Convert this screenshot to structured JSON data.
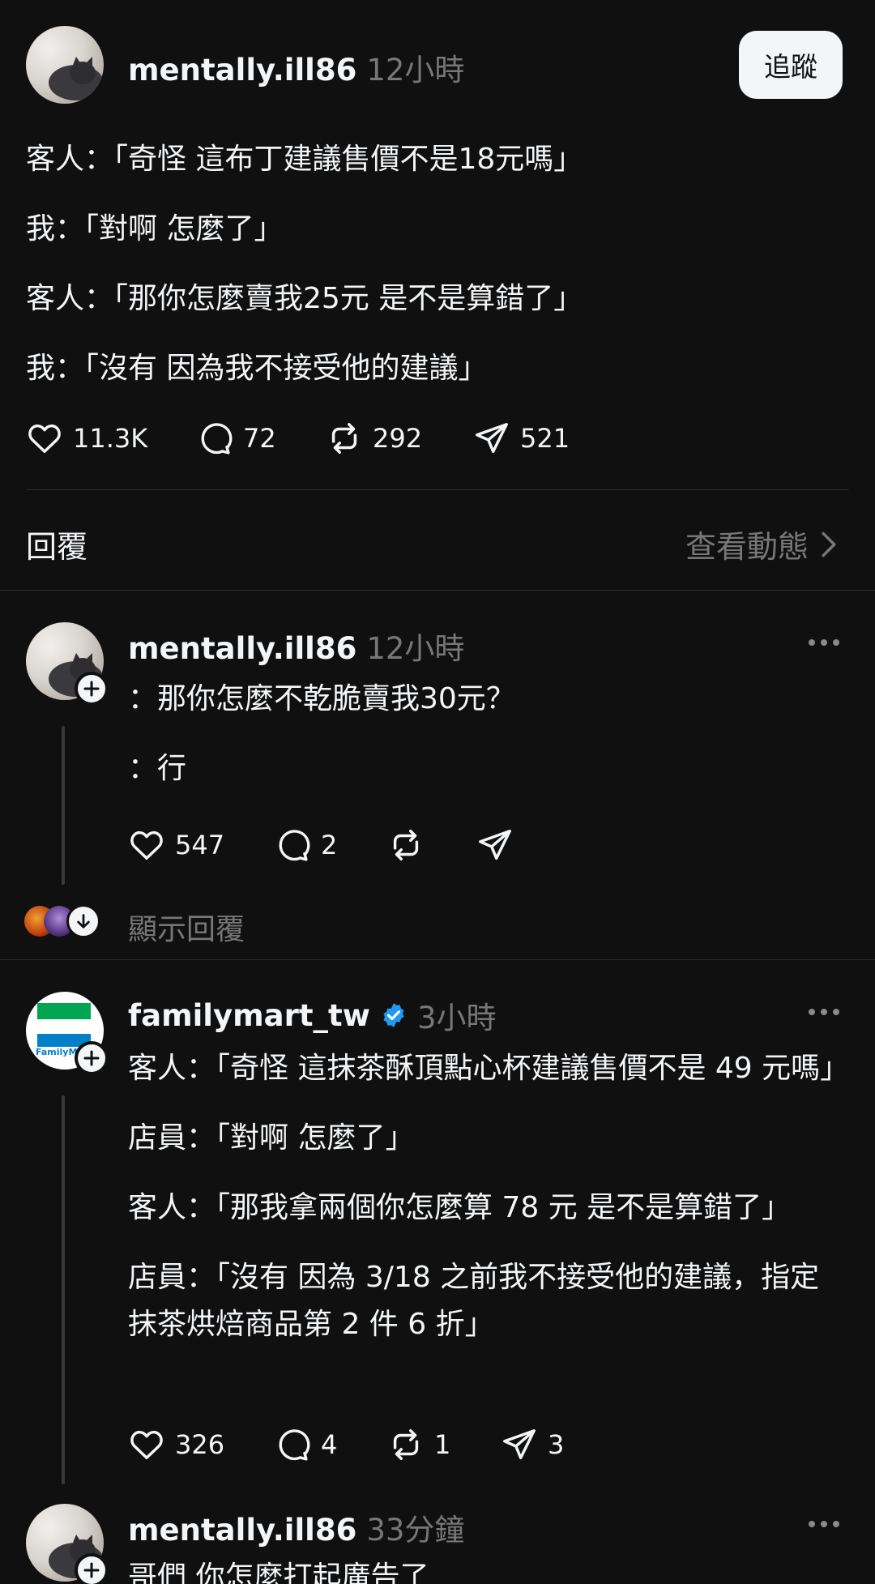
{
  "main_post": {
    "username": "mentally.ill86",
    "time": "12小時",
    "follow_label": "追蹤",
    "lines": [
      "客人：「奇怪 這布丁建議售價不是18元嗎」",
      "我：「對啊 怎麼了」",
      "客人：「那你怎麼賣我25元 是不是算錯了」",
      "我：「沒有 因為我不接受他的建議」"
    ],
    "likes": "11.3K",
    "comments": "72",
    "reposts": "292",
    "shares": "521"
  },
  "replies_header": {
    "label": "回覆",
    "activity_link": "查看動態"
  },
  "reply1": {
    "username": "mentally.ill86",
    "time": "12小時",
    "lines": [
      "：那你怎麼不乾脆賣我30元？",
      "：行"
    ],
    "likes": "547",
    "comments": "2",
    "show_replies": "顯示回覆"
  },
  "reply2": {
    "username": "familymart_tw",
    "time": "3小時",
    "avatar_text": "FamilyMart",
    "lines": [
      "客人：「奇怪 這抹茶酥頂點心杯建議售價不是 49 元嗎」",
      "店員：「對啊 怎麼了」",
      "客人：「那我拿兩個你怎麼算 78 元 是不是算錯了」",
      "店員：「沒有 因為 3/18 之前我不接受他的建議，指定抹茶烘焙商品第 2 件 6 折」"
    ],
    "likes": "326",
    "comments": "4",
    "reposts": "1",
    "shares": "3"
  },
  "reply3": {
    "username": "mentally.ill86",
    "time": "33分鐘",
    "line": "哥們 你怎麼打起廣告了"
  },
  "colors": {
    "background": "#101010",
    "text": "#f3f5f7",
    "muted": "#777777",
    "verified": "#1d9bf0"
  },
  "icons": [
    "heart-icon",
    "comment-icon",
    "repost-icon",
    "share-icon",
    "chevron-right-icon",
    "more-icon",
    "plus-icon",
    "arrow-down-icon",
    "verified-icon"
  ]
}
